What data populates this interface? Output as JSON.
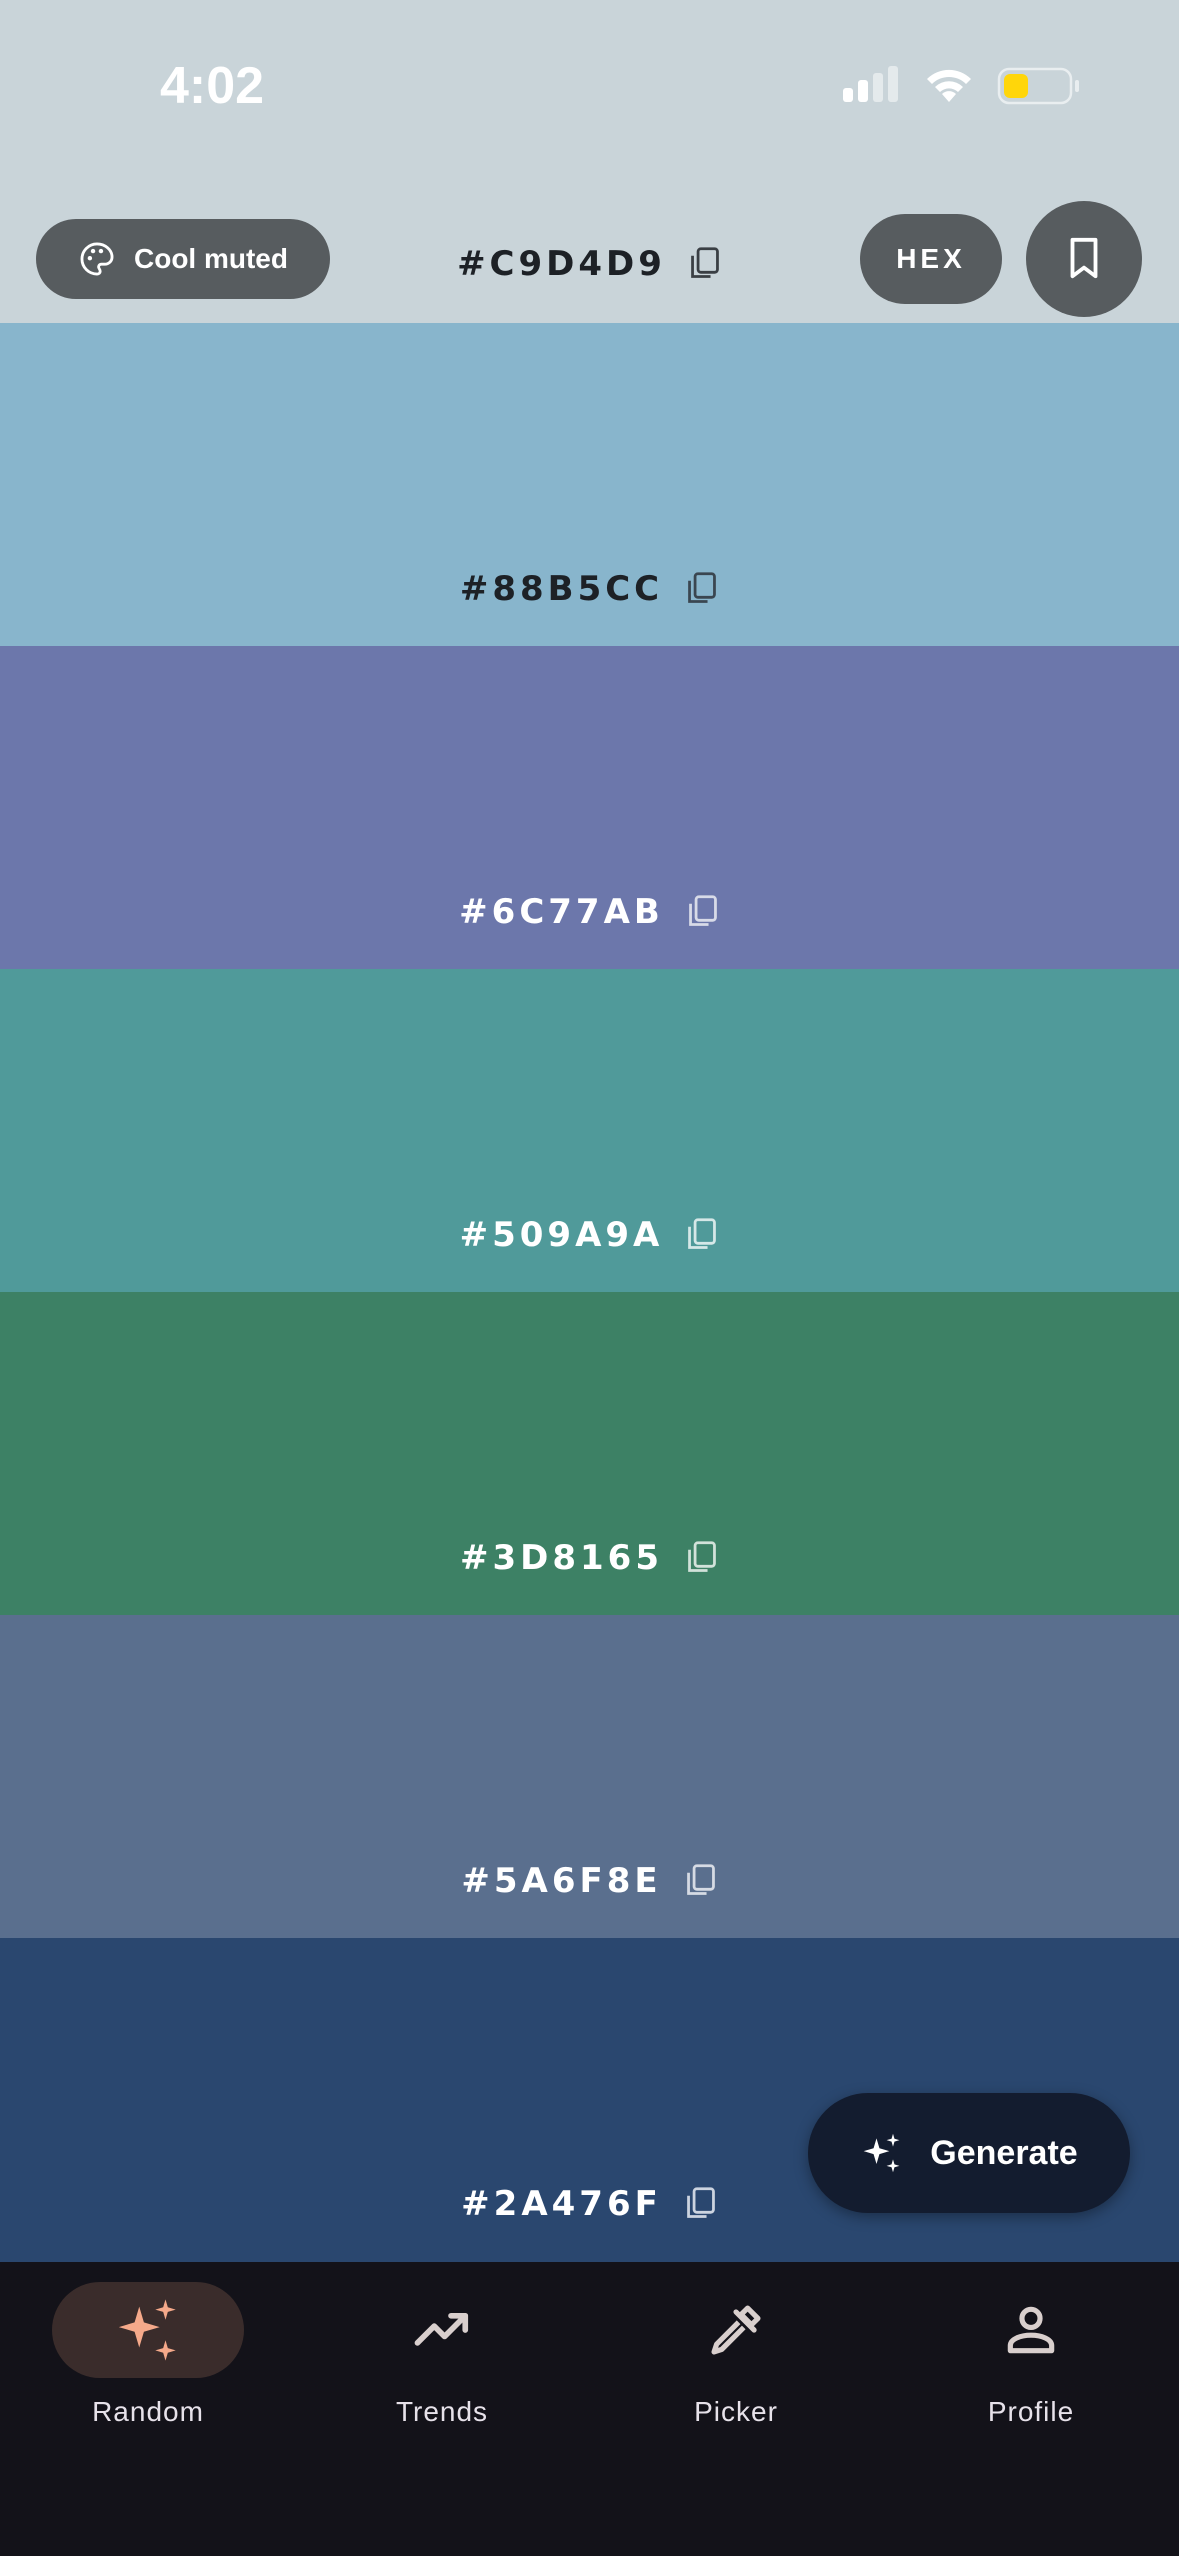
{
  "status_bar": {
    "time": "4:02"
  },
  "palette": {
    "style_label": "Cool muted",
    "format_label": "HEX",
    "swatches": [
      {
        "hex": "#C9D4D9",
        "color": "#C9D4D9"
      },
      {
        "hex": "#88B5CC",
        "color": "#88B5CC"
      },
      {
        "hex": "#6C77AB",
        "color": "#6C77AB"
      },
      {
        "hex": "#509A9A",
        "color": "#509A9A"
      },
      {
        "hex": "#3D8165",
        "color": "#3D8165"
      },
      {
        "hex": "#5A6F8E",
        "color": "#5A6F8E"
      },
      {
        "hex": "#2A476F",
        "color": "#2A476F"
      }
    ]
  },
  "generate_label": "Generate",
  "nav": {
    "items": [
      {
        "label": "Random",
        "icon": "sparkles-icon",
        "active": true
      },
      {
        "label": "Trends",
        "icon": "trending-up-icon"
      },
      {
        "label": "Picker",
        "icon": "eyedropper-icon"
      },
      {
        "label": "Profile",
        "icon": "person-icon"
      }
    ]
  },
  "colors": {
    "accent": "#F5A98A",
    "nav_bg": "#131219",
    "active_pill": "#3A2C2B",
    "pill_bg": "#575C5F",
    "battery": "#FFD60A"
  }
}
